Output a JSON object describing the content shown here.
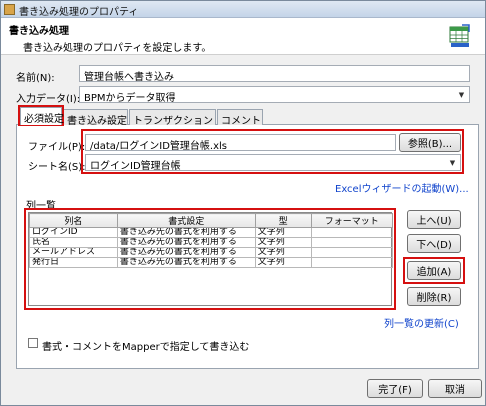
{
  "window": {
    "title": "書き込み処理のプロパティ"
  },
  "header": {
    "title": "書き込み処理",
    "description": "書き込み処理のプロパティを設定します。",
    "icon": "table-write-icon"
  },
  "form": {
    "name_label": "名前(N):",
    "name_value": "管理台帳へ書き込み",
    "input_label": "入力データ(I):",
    "input_value": "BPMからデータ取得"
  },
  "tabs": [
    {
      "label": "必須設定",
      "active": true
    },
    {
      "label": "書き込み設定",
      "active": false
    },
    {
      "label": "トランザクション",
      "active": false
    },
    {
      "label": "コメント",
      "active": false
    }
  ],
  "required": {
    "file_label": "ファイル(P):",
    "file_value": "/data/ログインID管理台帳.xls",
    "browse_label": "参照(B)...",
    "sheet_label": "シート名(S):",
    "sheet_value": "ログインID管理台帳",
    "excel_wizard_link": "Excelウィザードの起動(W)..."
  },
  "columns_section": {
    "title": "列一覧",
    "headers": [
      "列名",
      "書式設定",
      "型",
      "フォーマット"
    ],
    "rows": [
      [
        "ログインID",
        "書き込み先の書式を利用する",
        "文字列",
        ""
      ],
      [
        "氏名",
        "書き込み先の書式を利用する",
        "文字列",
        ""
      ],
      [
        "メールアドレス",
        "書き込み先の書式を利用する",
        "文字列",
        ""
      ],
      [
        "発行日",
        "書き込み先の書式を利用する",
        "文字列",
        ""
      ]
    ],
    "up_label": "上へ(U)",
    "down_label": "下へ(D)",
    "add_label": "追加(A)",
    "delete_label": "削除(R)",
    "refresh_link": "列一覧の更新(C)",
    "mapper_checkbox_label": "書式・コメントをMapperで指定して書き込む",
    "mapper_checked": false
  },
  "footer": {
    "ok_label": "完了(F)",
    "cancel_label": "取消"
  },
  "colors": {
    "highlight": "#d51010",
    "link": "#1144cc"
  }
}
